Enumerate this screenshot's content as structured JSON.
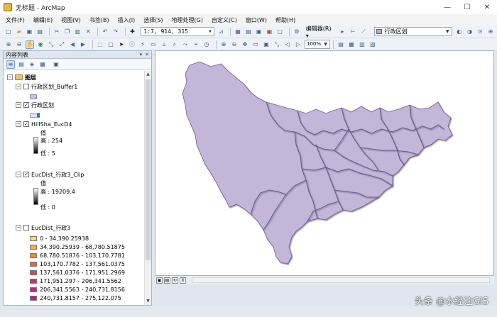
{
  "window": {
    "title": "无标题 - ArcMap",
    "controls": [
      "—",
      "☐",
      "✕"
    ]
  },
  "menu": [
    "文件(F)",
    "编辑(E)",
    "视图(V)",
    "书签(B)",
    "插入(I)",
    "选择(S)",
    "地理处理(G)",
    "自定义(C)",
    "窗口(W)",
    "帮助(H)"
  ],
  "toolbar": {
    "scale": "1:7, 914, 315",
    "editor_label": "编辑器(R) ▾",
    "target_layer": "行政区划",
    "zoom": "100%"
  },
  "toc": {
    "title": "内容列表",
    "header_buttons": [
      "▾",
      "✕"
    ],
    "root_label": "图层",
    "layers": [
      {
        "name": "行政区划_Buffer1",
        "checked": false
      },
      {
        "name": "行政区划",
        "checked": true
      },
      {
        "name": "HillSha_EucD4",
        "checked": true,
        "value_label": "值",
        "high": "高 : 254",
        "low": "低 : 5"
      },
      {
        "name": "EucDist_行政3_Clip",
        "checked": true,
        "value_label": "值",
        "high": "高 : 19209.4",
        "low": "低 : 0"
      },
      {
        "name": "EucDist_行政3",
        "checked": false,
        "classes": [
          {
            "label": "0 - 34,390.25938",
            "color": "#fbd96b"
          },
          {
            "label": "34,390.25939 - 68,780.51875",
            "color": "#f3b03a"
          },
          {
            "label": "68,780.51876 - 103,170.7781",
            "color": "#ef8a3a"
          },
          {
            "label": "103,170.7782 - 137,561.0375",
            "color": "#e8633e"
          },
          {
            "label": "137,561.0376 - 171,951.2969",
            "color": "#e04553"
          },
          {
            "label": "171,951.297 - 206,341.5562",
            "color": "#d72b6b"
          },
          {
            "label": "206,341.5563 - 240,731.8156",
            "color": "#cc1f86"
          },
          {
            "label": "240,731.8157 - 275,122.075",
            "color": "#c0189e"
          }
        ]
      }
    ]
  },
  "map": {
    "fill": "#c3b6d9",
    "stroke": "#6c5d88"
  },
  "watermark": "头条 @水经注GIS"
}
